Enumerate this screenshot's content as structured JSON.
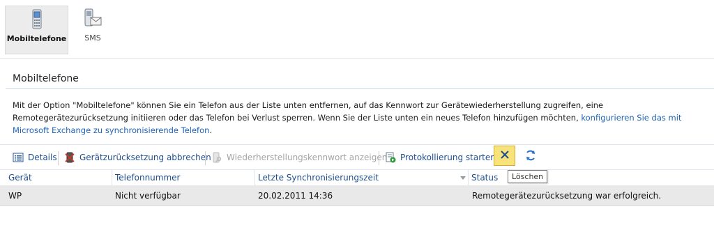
{
  "nav": {
    "tabs": [
      {
        "label": "Mobiltelefone",
        "icon": "mobile-phone-icon",
        "active": true
      },
      {
        "label": "SMS",
        "icon": "sms-icon",
        "active": false
      }
    ]
  },
  "main": {
    "title": "Mobiltelefone",
    "description": "Mit der Option \"Mobiltelefone\" können Sie ein Telefon aus der Liste unten entfernen, auf das Kennwort zur Gerätewiederherstellung zugreifen, eine Remotegerätezurücksetzung initiieren oder das Telefon bei Verlust sperren. Wenn Sie der Liste unten ein neues Telefon hinzufügen möchten, ",
    "description_link": "konfigurieren Sie das mit Microsoft Exchange zu synchronisierende Telefon",
    "description_end": "."
  },
  "toolbar": {
    "details": "Details",
    "cancel_reset": "Gerätzurücksetzung abbrechen",
    "show_recovery_password": "Wiederherstellungskennwort anzeigen",
    "start_logging": "Protokollierung starten",
    "delete_tooltip": "Löschen",
    "colors": {
      "link": "#1f4e8c",
      "disabled": "#a4a4a4",
      "highlight": "#f8e27a"
    }
  },
  "grid": {
    "columns": [
      "Gerät",
      "Telefonnummer",
      "Letzte Synchronisierungszeit",
      "Status"
    ],
    "rows": [
      {
        "device": "WP",
        "phone": "Nicht verfügbar",
        "last_sync": "20.02.2011 14:36",
        "status": "Remotegerätezurücksetzung war erfolgreich."
      }
    ]
  }
}
